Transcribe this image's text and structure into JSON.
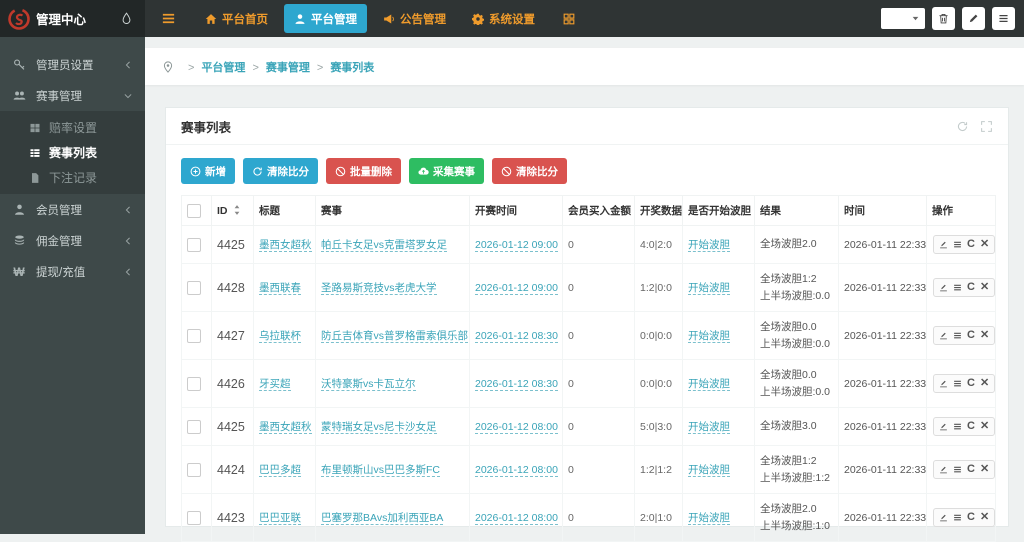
{
  "topbar": {
    "brand": "管理中心",
    "menu": [
      {
        "label": "平台首页",
        "icon": "home",
        "active": false
      },
      {
        "label": "平台管理",
        "icon": "user",
        "active": true
      },
      {
        "label": "公告管理",
        "icon": "megaphone",
        "active": false
      },
      {
        "label": "系统设置",
        "icon": "gear",
        "active": false
      }
    ]
  },
  "sidebar": {
    "items": [
      {
        "label": "管理员设置",
        "icon": "key",
        "state": "collapsed"
      },
      {
        "label": "赛事管理",
        "icon": "users",
        "state": "expanded",
        "children": [
          {
            "label": "赔率设置",
            "icon": "th",
            "active": false
          },
          {
            "label": "赛事列表",
            "icon": "thlist",
            "active": true
          },
          {
            "label": "下注记录",
            "icon": "file",
            "active": false
          }
        ]
      },
      {
        "label": "会员管理",
        "icon": "member",
        "state": "collapsed"
      },
      {
        "label": "佣金管理",
        "icon": "layers",
        "state": "collapsed"
      },
      {
        "label": "提现/充值",
        "icon": "won",
        "state": "collapsed"
      }
    ]
  },
  "breadcrumb": [
    "平台管理",
    "赛事管理",
    "赛事列表"
  ],
  "panel": {
    "title": "赛事列表",
    "buttons": [
      {
        "label": "新增",
        "color": "blue",
        "icon": "plus"
      },
      {
        "label": "清除比分",
        "color": "blue",
        "icon": "refresh"
      },
      {
        "label": "批量删除",
        "color": "red",
        "icon": "ban"
      },
      {
        "label": "采集赛事",
        "color": "green",
        "icon": "cloud"
      },
      {
        "label": "清除比分",
        "color": "red",
        "icon": "ban"
      }
    ],
    "table": {
      "columns": [
        "ID",
        "标题",
        "赛事",
        "开赛时间",
        "会员买入金额",
        "开奖数据",
        "是否开始波胆",
        "结果",
        "时间",
        "操作"
      ],
      "rows": [
        {
          "id": "4425",
          "title": "墨西女超秋",
          "match": "帕丘卡女足vs克雷塔罗女足",
          "start_time": "2026-01-12 09:00",
          "amount": "0",
          "draw": "4:0|2:0",
          "bodan": "开始波胆",
          "result": [
            "全场波胆2.0"
          ],
          "time": "2026-01-11 22:33"
        },
        {
          "id": "4428",
          "title": "墨西联春",
          "match": "圣路易斯竞技vs老虎大学",
          "start_time": "2026-01-12 09:00",
          "amount": "0",
          "draw": "1:2|0:0",
          "bodan": "开始波胆",
          "result": [
            "全场波胆1:2",
            "上半场波胆:0.0"
          ],
          "time": "2026-01-11 22:33"
        },
        {
          "id": "4427",
          "title": "乌拉联杯",
          "match": "防丘吉体育vs普罗格雷索俱乐部",
          "start_time": "2026-01-12 08:30",
          "amount": "0",
          "draw": "0:0|0:0",
          "bodan": "开始波胆",
          "result": [
            "全场波胆0.0",
            "上半场波胆:0.0"
          ],
          "time": "2026-01-11 22:33"
        },
        {
          "id": "4426",
          "title": "牙买超",
          "match": "沃特豪斯vs卡瓦立尔",
          "start_time": "2026-01-12 08:30",
          "amount": "0",
          "draw": "0:0|0:0",
          "bodan": "开始波胆",
          "result": [
            "全场波胆0.0",
            "上半场波胆:0.0"
          ],
          "time": "2026-01-11 22:33"
        },
        {
          "id": "4425",
          "title": "墨西女超秋",
          "match": "蒙特瑞女足vs尼卡沙女足",
          "start_time": "2026-01-12 08:00",
          "amount": "0",
          "draw": "5:0|3:0",
          "bodan": "开始波胆",
          "result": [
            "全场波胆3.0"
          ],
          "time": "2026-01-11 22:33"
        },
        {
          "id": "4424",
          "title": "巴巴多超",
          "match": "布里顿斯山vs巴巴多斯FC",
          "start_time": "2026-01-12 08:00",
          "amount": "0",
          "draw": "1:2|1:2",
          "bodan": "开始波胆",
          "result": [
            "全场波胆1:2",
            "上半场波胆:1:2"
          ],
          "time": "2026-01-11 22:33"
        },
        {
          "id": "4423",
          "title": "巴巴亚联",
          "match": "巴塞罗那BAvs加利西亚BA",
          "start_time": "2026-01-12 08:00",
          "amount": "0",
          "draw": "2:0|1:0",
          "bodan": "开始波胆",
          "result": [
            "全场波胆2.0",
            "上半场波胆:1:0"
          ],
          "time": "2026-01-11 22:33"
        }
      ]
    }
  }
}
